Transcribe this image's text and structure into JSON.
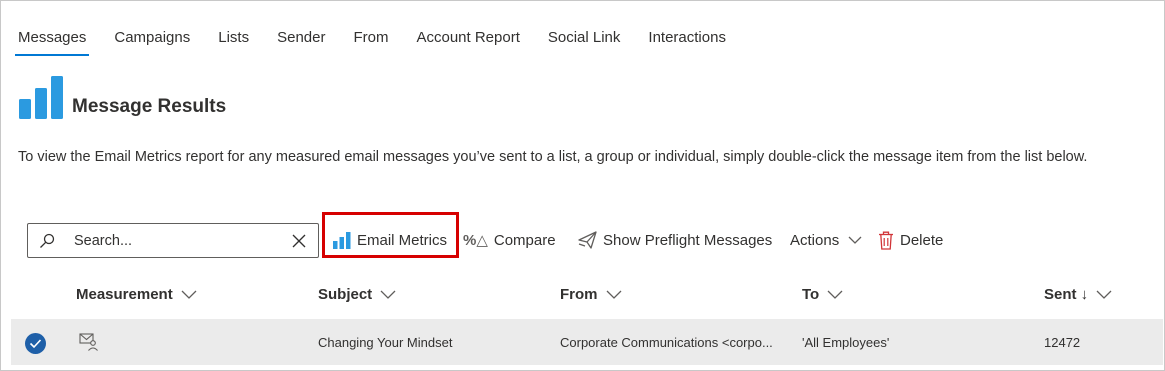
{
  "tabs": [
    {
      "label": "Messages",
      "active": true
    },
    {
      "label": "Campaigns"
    },
    {
      "label": "Lists"
    },
    {
      "label": "Sender"
    },
    {
      "label": "From"
    },
    {
      "label": "Account Report"
    },
    {
      "label": "Social Link"
    },
    {
      "label": "Interactions"
    }
  ],
  "header": {
    "title": "Message Results",
    "icon": "bar-chart-icon",
    "description": "To view the Email Metrics report for any measured email messages you’ve sent to a list, a group or individual, simply double-click the message item from the list below."
  },
  "toolbar": {
    "search_placeholder": "Search...",
    "email_metrics_label": "Email Metrics",
    "compare_label": "Compare",
    "compare_icon_text": "%△",
    "preflight_label": "Show Preflight Messages",
    "actions_label": "Actions",
    "delete_label": "Delete",
    "highlight_color": "#d60000"
  },
  "table": {
    "columns": [
      "Measurement",
      "Subject",
      "From",
      "To",
      "Sent ↓"
    ],
    "rows": [
      {
        "selected": true,
        "measurement_icon": "envelope-person-icon",
        "subject": "Changing Your Mindset",
        "from": "Corporate Communications <corpo...",
        "to": "'All Employees'",
        "sent": "12472"
      }
    ]
  },
  "colors": {
    "accent": "#0078d4",
    "chart_icon": "#2b9ae0",
    "delete_icon": "#d13438",
    "selected_row": "#ebebeb",
    "check": "#1e5fa8"
  }
}
